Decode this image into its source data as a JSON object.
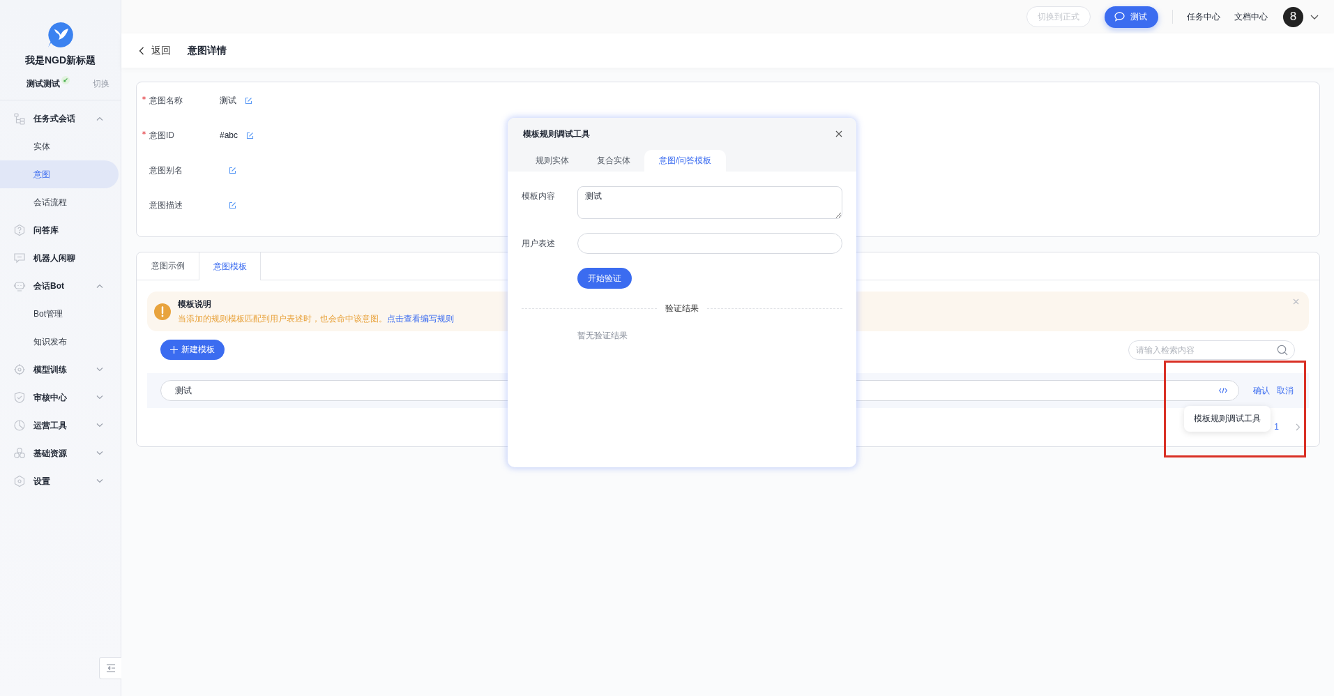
{
  "sidebar": {
    "app_title": "我是NGD新标题",
    "workspace": "测试测试",
    "workspace_switch": "切换",
    "items": [
      {
        "label": "任务式会话",
        "expanded": true,
        "selected": false,
        "children": [
          {
            "label": "实体",
            "selected": false
          },
          {
            "label": "意图",
            "selected": true
          },
          {
            "label": "会话流程",
            "selected": false
          }
        ]
      },
      {
        "label": "问答库",
        "selected": false
      },
      {
        "label": "机器人闲聊",
        "selected": false
      },
      {
        "label": "会话Bot",
        "expanded": true,
        "selected": false,
        "children": [
          {
            "label": "Bot管理",
            "selected": false
          },
          {
            "label": "知识发布",
            "selected": false
          }
        ]
      },
      {
        "label": "模型训练",
        "expanded": false,
        "selected": false
      },
      {
        "label": "审核中心",
        "expanded": false,
        "selected": false
      },
      {
        "label": "运营工具",
        "expanded": false,
        "selected": false
      },
      {
        "label": "基础资源",
        "expanded": false,
        "selected": false
      },
      {
        "label": "设置",
        "expanded": false,
        "selected": false
      }
    ]
  },
  "top_bar": {
    "switch_button": {
      "label": "切换到正式",
      "disabled": true
    },
    "test_button": "测试",
    "links": [
      "任务中心",
      "文档中心"
    ],
    "avatar": "8"
  },
  "header": {
    "back": "返回",
    "title": "意图详情"
  },
  "fields": [
    {
      "label": "意图名称",
      "required": true,
      "value": "测试"
    },
    {
      "label": "意图ID",
      "required": true,
      "value": "#abc"
    },
    {
      "label": "意图别名",
      "required": false
    },
    {
      "label": "意图描述",
      "required": false
    }
  ],
  "tabs": [
    {
      "label": "意图示例",
      "selected": false
    },
    {
      "label": "意图模板",
      "selected": true
    }
  ],
  "notice": {
    "title": "模板说明",
    "text": "当添加的规则模板匹配到用户表述时，也会命中该意图。",
    "link": "点击查看编写规则"
  },
  "new_button": "新建模板",
  "search": {
    "placeholder": "请输入检索内容"
  },
  "template_row": {
    "value": "测试",
    "confirm": "确认",
    "cancel": "取消",
    "tooltip": "模板规则调试工具"
  },
  "pagination": {
    "pages": [
      {
        "label": "1",
        "selected": true
      }
    ]
  },
  "dialog": {
    "title": "模板规则调试工具",
    "tabs": [
      {
        "label": "规则实体",
        "selected": false
      },
      {
        "label": "复合实体",
        "selected": false
      },
      {
        "label": "意图/问答模板",
        "selected": true
      }
    ],
    "content_label": "模板内容",
    "content_value": "测试",
    "utterance_label": "用户表述",
    "verify_button": "开始验证",
    "result_heading": "验证结果",
    "result_empty": "暂无验证结果"
  }
}
